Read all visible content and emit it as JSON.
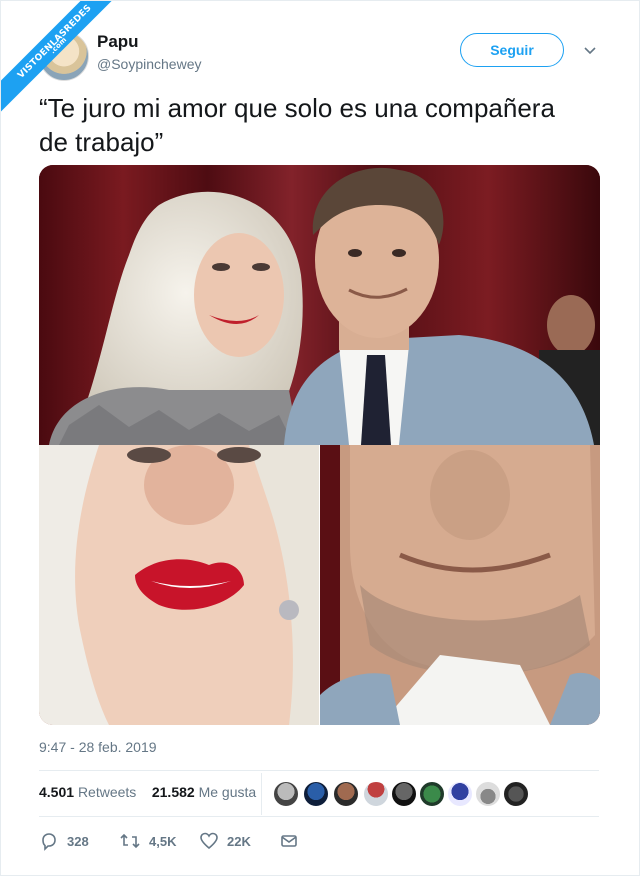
{
  "watermark": {
    "text": "VISTOENLASREDES",
    "sub": ".com"
  },
  "author": {
    "name": "Papu",
    "handle": "@Soypinchewey"
  },
  "follow_label": "Seguir",
  "tweet": {
    "line1": "“Te juro mi amor que solo es una compañera",
    "line2": "de trabajo”"
  },
  "timestamp": "9:47 - 28 feb. 2019",
  "stats": {
    "retweets_count": "4.501",
    "retweets_label": "Retweets",
    "likes_count": "21.582",
    "likes_label": "Me gusta"
  },
  "actions": {
    "replies": "328",
    "retweets": "4,5K",
    "likes": "22K"
  },
  "icons": {
    "chevron": "chevron-down-icon",
    "reply": "reply-icon",
    "retweet": "retweet-icon",
    "like": "heart-icon",
    "message": "envelope-icon"
  },
  "colors": {
    "accent": "#1da1f2",
    "text": "#14171a",
    "muted": "#657786"
  }
}
